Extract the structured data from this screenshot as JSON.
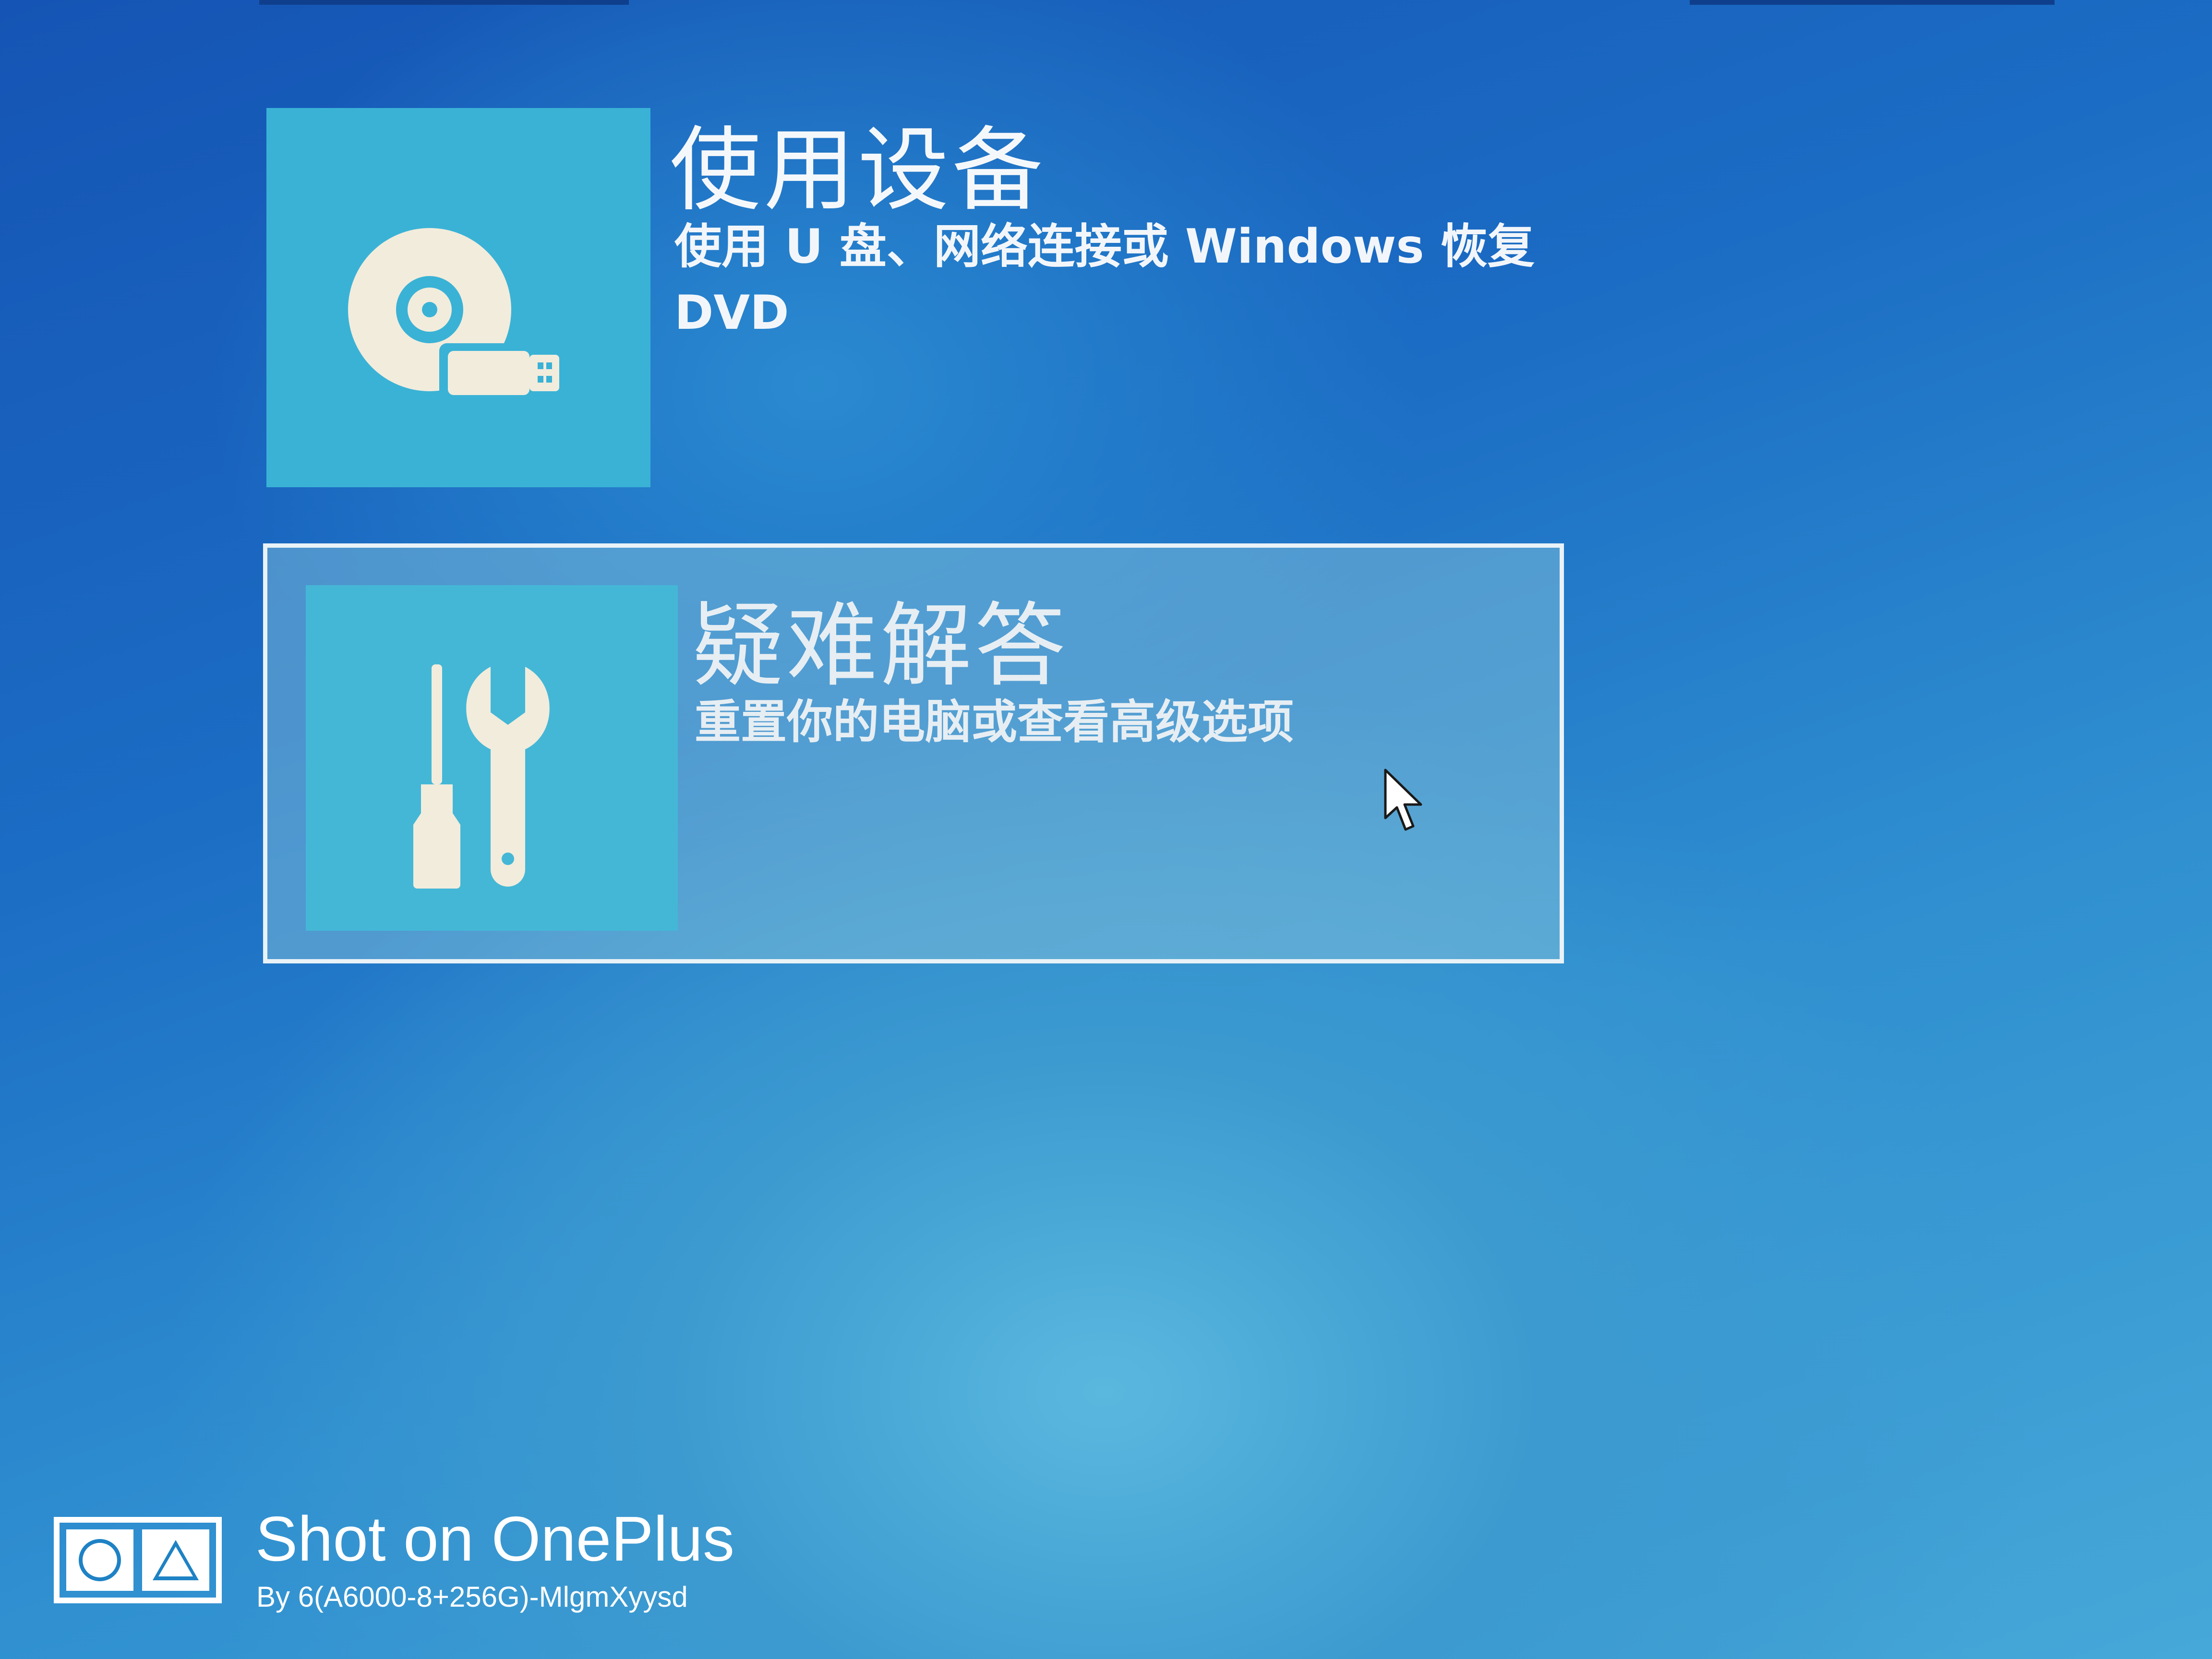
{
  "options": [
    {
      "title": "使用设备",
      "description": "使用 U 盘、网络连接或 Windows 恢复 DVD",
      "icon": "disc-usb-icon"
    },
    {
      "title": "疑难解答",
      "description": "重置你的电脑或查看高级选项",
      "icon": "tools-icon",
      "selected": true
    }
  ],
  "watermark": {
    "title": "Shot on OnePlus",
    "subtitle": "By 6(A6000-8+256G)-MlgmXyysd",
    "icon": "camera-logo-icon"
  },
  "colors": {
    "background_top": "#1554b4",
    "background_bottom": "#46a8d8",
    "tile": "#3ab2d6",
    "text": "#ffffff"
  }
}
